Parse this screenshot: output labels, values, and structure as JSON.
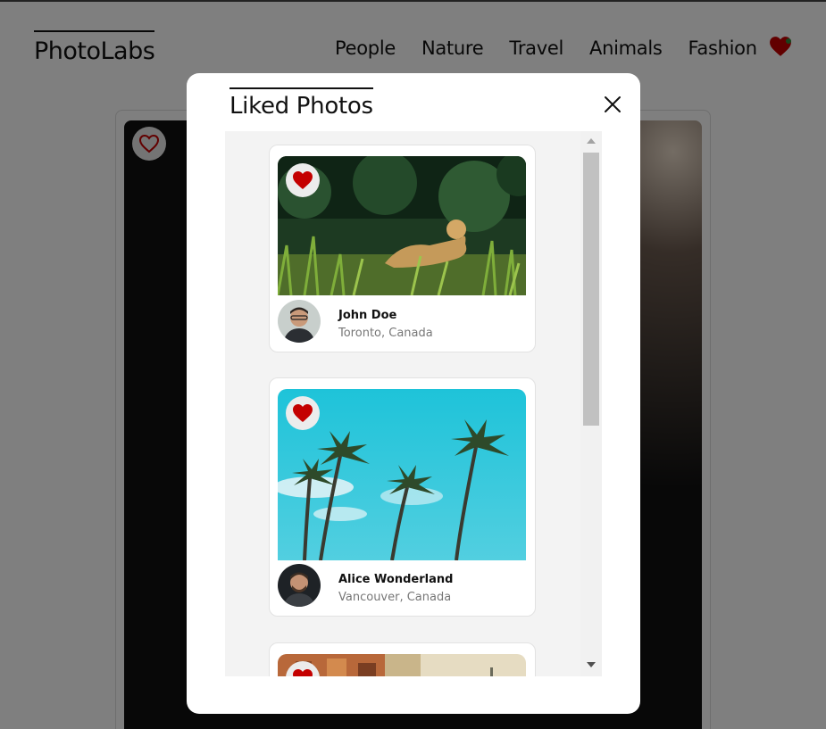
{
  "app": {
    "logo": "PhotoLabs"
  },
  "topics": [
    "People",
    "Nature",
    "Travel",
    "Animals",
    "Fashion"
  ],
  "modal": {
    "title": "Liked Photos"
  },
  "liked_photos": [
    {
      "user": "John Doe",
      "location": "Toronto, Canada"
    },
    {
      "user": "Alice Wonderland",
      "location": "Vancouver, Canada"
    }
  ],
  "colors": {
    "heart": "#c40000",
    "overlay": "rgba(0,0,0,0.5)"
  },
  "icons": {
    "favourite": "heart-icon",
    "close": "close-icon"
  }
}
